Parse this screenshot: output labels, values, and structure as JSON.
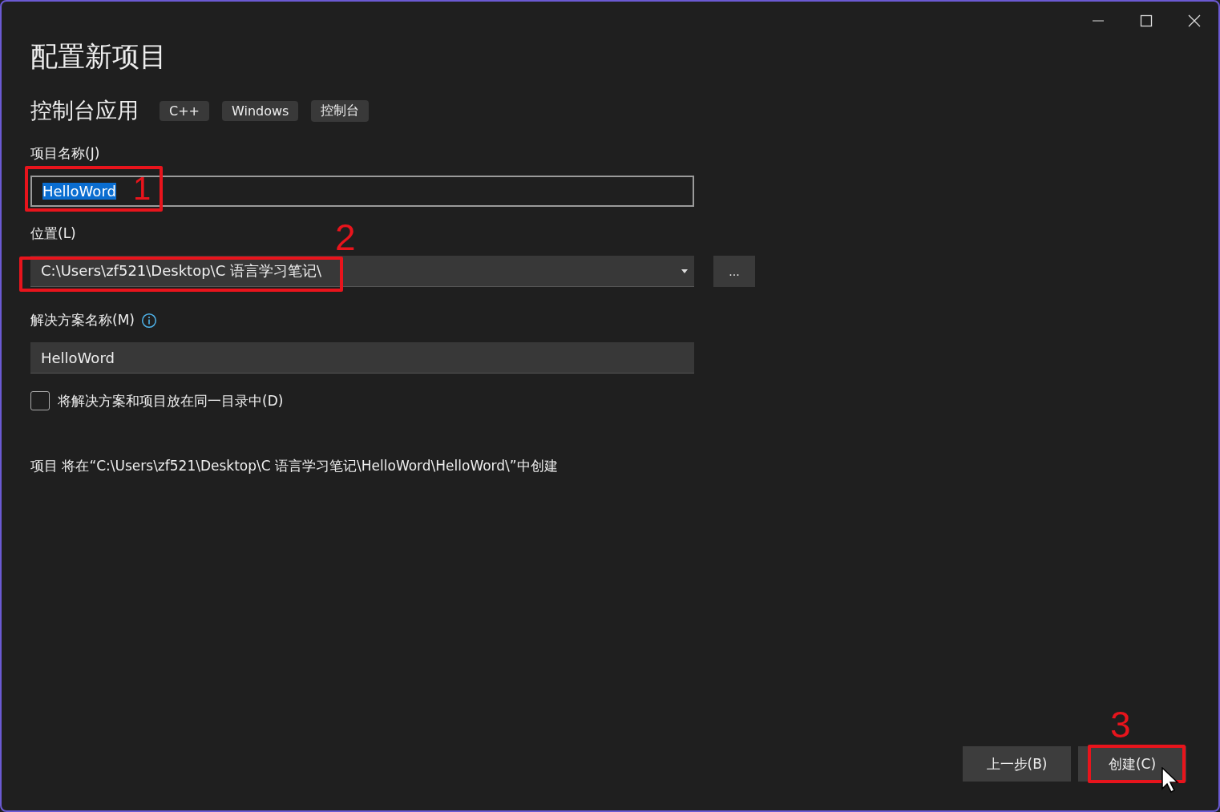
{
  "window": {
    "title": "配置新项目"
  },
  "template": {
    "name": "控制台应用",
    "tags": [
      "C++",
      "Windows",
      "控制台"
    ]
  },
  "project_name": {
    "label": "项目名称(J)",
    "value": "HelloWord",
    "text_selected": true,
    "annotation": "1"
  },
  "location": {
    "label": "位置(L)",
    "value": "C:\\Users\\zf521\\Desktop\\C 语言学习笔记\\",
    "browse": "...",
    "annotation": "2"
  },
  "solution_name": {
    "label": "解决方案名称(M)",
    "value": "HelloWord"
  },
  "same_directory": {
    "label": "将解决方案和项目放在同一目录中(D)",
    "checked": false
  },
  "summary": "项目 将在“C:\\Users\\zf521\\Desktop\\C 语言学习笔记\\HelloWord\\HelloWord\\”中创建",
  "buttons": [
    {
      "label": "上一步(B)"
    },
    {
      "label": "创建(C)",
      "annotation": "3"
    }
  ]
}
